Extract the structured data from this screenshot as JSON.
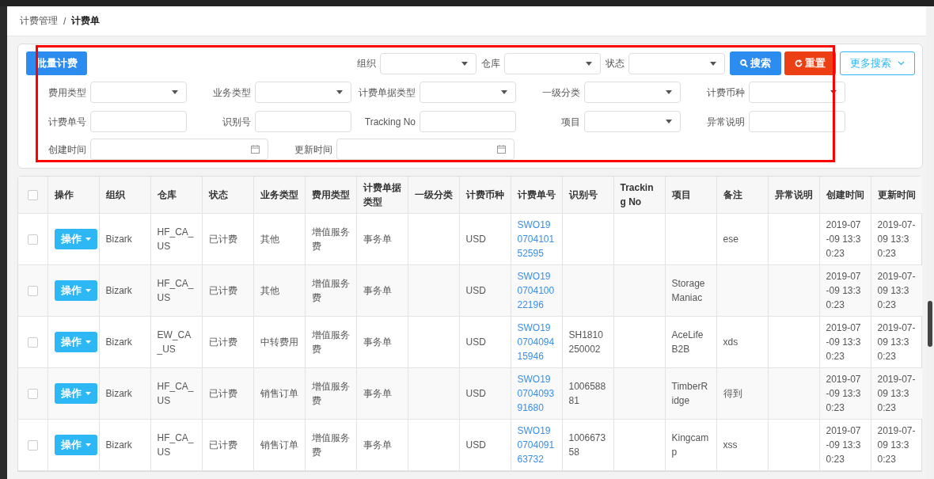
{
  "breadcrumb": {
    "separator": "/",
    "items": [
      {
        "label": "计费管理",
        "current": false
      },
      {
        "label": "计费单",
        "current": true
      }
    ]
  },
  "filter": {
    "batch_button": "批量计费",
    "search_button": "搜索",
    "reset_button": "重置",
    "more_button": "更多搜索",
    "top_fields": [
      {
        "label": "组织",
        "kind": "select"
      },
      {
        "label": "仓库",
        "kind": "select"
      },
      {
        "label": "状态",
        "kind": "select"
      }
    ],
    "fields": [
      {
        "label": "费用类型",
        "kind": "select"
      },
      {
        "label": "业务类型",
        "kind": "select"
      },
      {
        "label": "计费单据类型",
        "kind": "select"
      },
      {
        "label": "一级分类",
        "kind": "select"
      },
      {
        "label": "计费币种",
        "kind": "select"
      },
      {
        "label": "计费单号",
        "kind": "text"
      },
      {
        "label": "识别号",
        "kind": "text"
      },
      {
        "label": "Tracking No",
        "kind": "text"
      },
      {
        "label": "项目",
        "kind": "select"
      },
      {
        "label": "异常说明",
        "kind": "text"
      }
    ],
    "date_fields": [
      {
        "label": "创建时间",
        "kind": "date"
      },
      {
        "label": "更新时间",
        "kind": "date"
      }
    ]
  },
  "table": {
    "header_checked": false,
    "columns": [
      {
        "label": "操作",
        "kind": "action"
      },
      {
        "label": "组织",
        "kind": "text"
      },
      {
        "label": "仓库",
        "kind": "text"
      },
      {
        "label": "状态",
        "kind": "text"
      },
      {
        "label": "业务类型",
        "kind": "text"
      },
      {
        "label": "费用类型",
        "kind": "text"
      },
      {
        "label": "计费单据类型",
        "kind": "text"
      },
      {
        "label": "一级分类",
        "kind": "text"
      },
      {
        "label": "计费币种",
        "kind": "text"
      },
      {
        "label": "计费单号",
        "kind": "link"
      },
      {
        "label": "识别号",
        "kind": "text"
      },
      {
        "label": "Tracking No",
        "kind": "text"
      },
      {
        "label": "项目",
        "kind": "text"
      },
      {
        "label": "备注",
        "kind": "text"
      },
      {
        "label": "异常说明",
        "kind": "text"
      },
      {
        "label": "创建时间",
        "kind": "text"
      },
      {
        "label": "更新时间",
        "kind": "text"
      }
    ],
    "rows": [
      {
        "checked": false,
        "cells": [
          "操作",
          "Bizark",
          "HF_CA_US",
          "已计费",
          "其他",
          "增值服务费",
          "事务单",
          null,
          "USD",
          "SWO19070410152595",
          null,
          null,
          null,
          "ese",
          null,
          "2019-07-09 13:30:23",
          "2019-07-09 13:30:23"
        ]
      },
      {
        "checked": false,
        "cells": [
          "操作",
          "Bizark",
          "HF_CA_US",
          "已计费",
          "其他",
          "增值服务费",
          "事务单",
          null,
          "USD",
          "SWO19070410022196",
          null,
          null,
          "StorageManiac",
          null,
          null,
          "2019-07-09 13:30:23",
          "2019-07-09 13:30:23"
        ]
      },
      {
        "checked": false,
        "cells": [
          "操作",
          "Bizark",
          "EW_CA_US",
          "已计费",
          "中转费用",
          "增值服务费",
          "事务单",
          null,
          "USD",
          "SWO19070409415946",
          "SH1810250002",
          null,
          "AceLife B2B",
          "xds",
          null,
          "2019-07-09 13:30:23",
          "2019-07-09 13:30:23"
        ]
      },
      {
        "checked": false,
        "cells": [
          "操作",
          "Bizark",
          "HF_CA_US",
          "已计费",
          "销售订单",
          "增值服务费",
          "事务单",
          null,
          "USD",
          "SWO19070409391680",
          "100658881",
          null,
          "TimberRidge",
          "得到",
          null,
          "2019-07-09 13:30:23",
          "2019-07-09 13:30:23"
        ]
      },
      {
        "checked": false,
        "cells": [
          "操作",
          "Bizark",
          "HF_CA_US",
          "已计费",
          "销售订单",
          "增值服务费",
          "事务单",
          null,
          "USD",
          "SWO19070409163732",
          "100667358",
          null,
          "Kingcamp",
          "xss",
          null,
          "2019-07-09 13:30:23",
          "2019-07-09 13:30:23"
        ]
      }
    ]
  }
}
